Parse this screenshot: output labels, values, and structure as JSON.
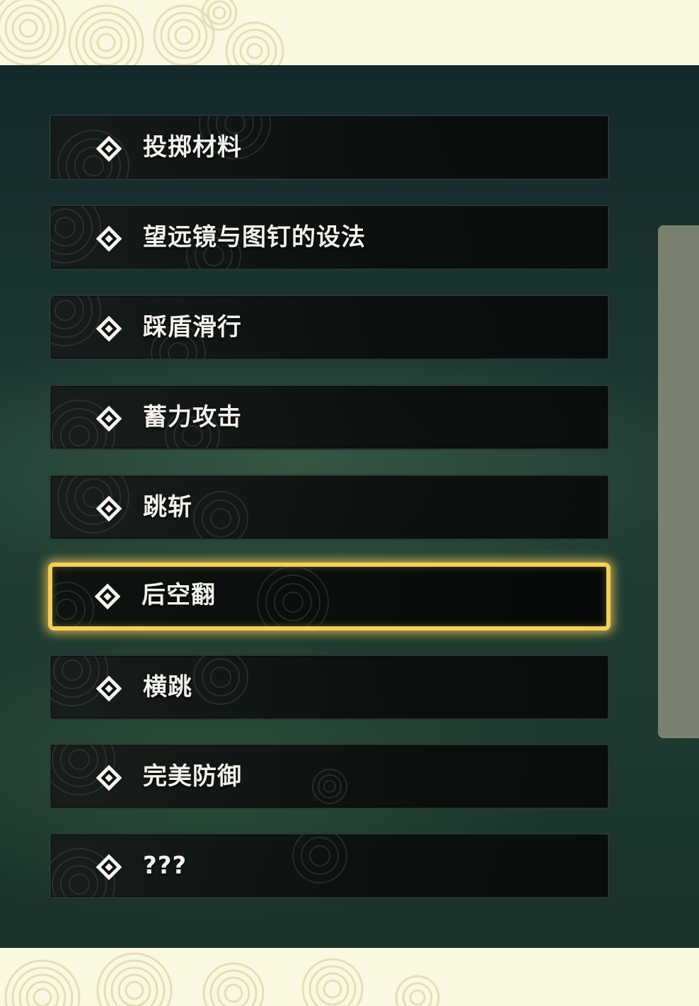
{
  "menu": {
    "items": [
      {
        "label": "投掷材料",
        "selected": false
      },
      {
        "label": "望远镜与图钉的设法",
        "selected": false
      },
      {
        "label": "踩盾滑行",
        "selected": false
      },
      {
        "label": "蓄力攻击",
        "selected": false
      },
      {
        "label": "跳斩",
        "selected": false
      },
      {
        "label": "后空翻",
        "selected": true
      },
      {
        "label": "横跳",
        "selected": false
      },
      {
        "label": "完美防御",
        "selected": false
      },
      {
        "label": "???",
        "selected": false
      }
    ]
  },
  "icons": {
    "item_marker": "diamond-icon"
  },
  "colors": {
    "parchment": "#fbf8e1",
    "scene_bg": "#1e3a31",
    "item_bg": "#0c100e",
    "selection_glow": "#f2cf5e",
    "label_text": "#f2f1ea",
    "scrollbar": "#7f8574"
  }
}
